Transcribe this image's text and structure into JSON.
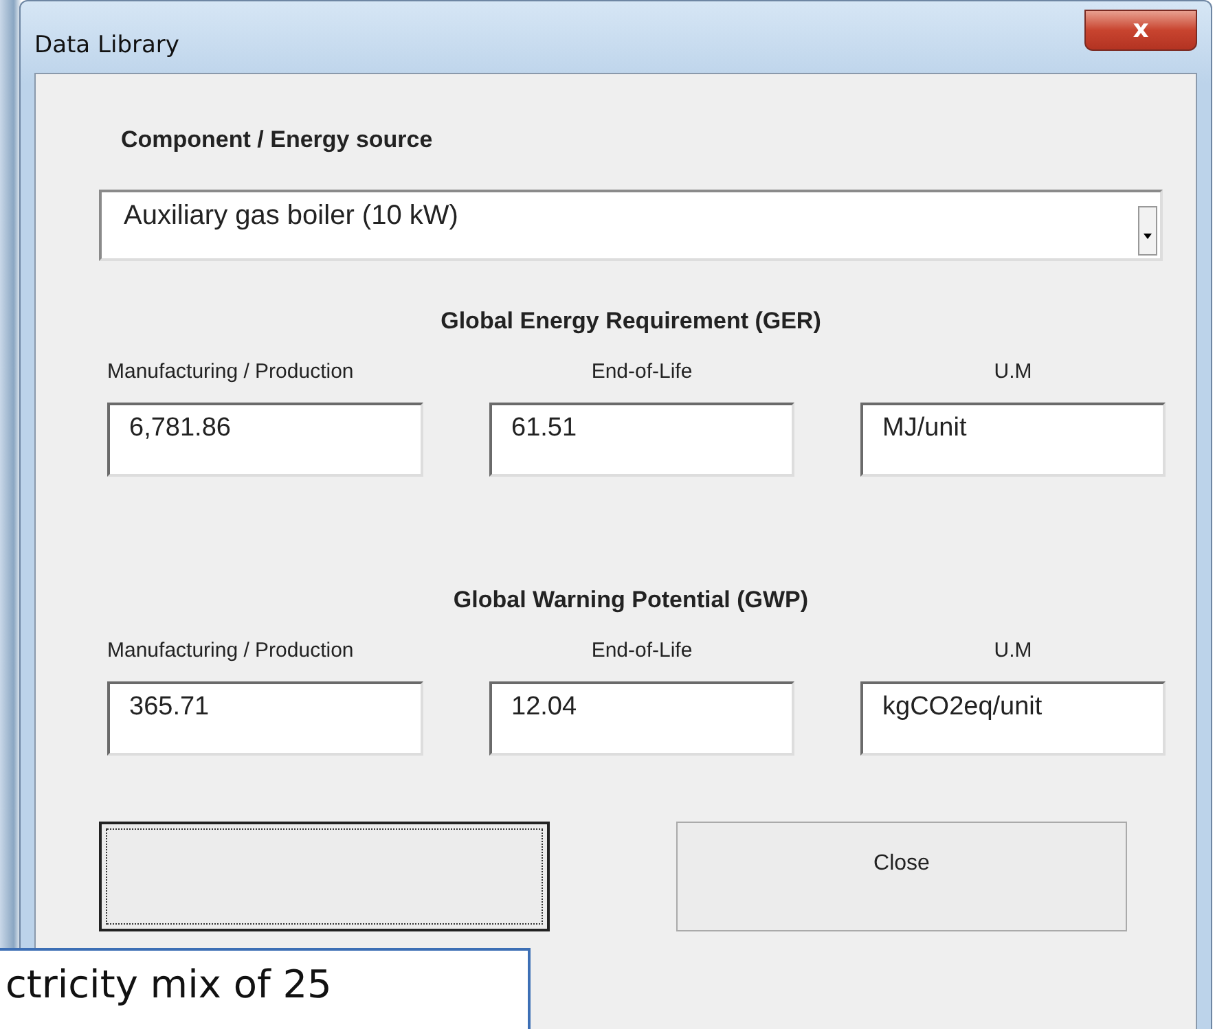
{
  "window": {
    "title": "Data Library",
    "close_glyph": "x"
  },
  "component": {
    "label": "Component / Energy source",
    "value": "Auxiliary gas boiler (10 kW)"
  },
  "sections": [
    {
      "heading": "Global Energy Requirement (GER)",
      "columns": [
        "Manufacturing / Production",
        "End-of-Life",
        "U.M"
      ],
      "values": [
        "6,781.86",
        "61.51",
        "MJ/unit"
      ]
    },
    {
      "heading": "Global Warning Potential (GWP)",
      "columns": [
        "Manufacturing / Production",
        "End-of-Life",
        "U.M"
      ],
      "values": [
        "365.71",
        "12.04",
        "kgCO2eq/unit"
      ]
    }
  ],
  "buttons": [
    {
      "focused": true
    },
    {
      "label": "Close",
      "focused": false
    }
  ],
  "overlay_text": "ctricity mix of 25"
}
